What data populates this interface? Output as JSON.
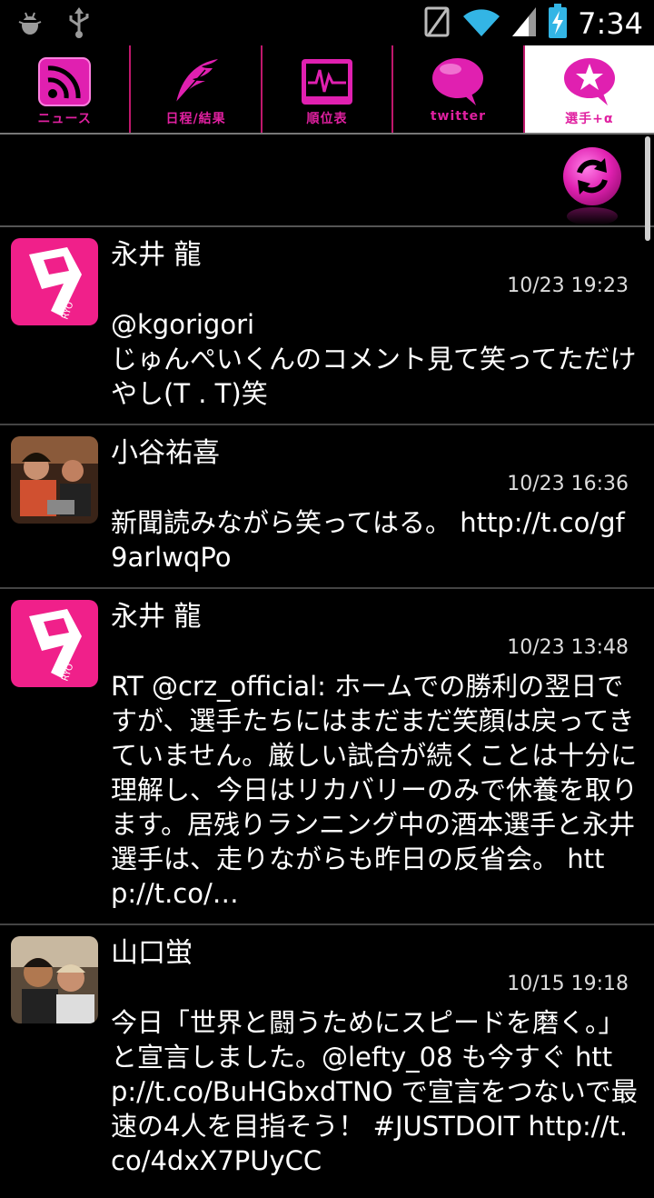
{
  "status_bar": {
    "time": "7:34",
    "icons": [
      "bug-icon",
      "usb-icon",
      "no-sim-icon",
      "wifi-icon",
      "signal-icon",
      "battery-charging-icon"
    ]
  },
  "tabs": [
    {
      "label": "ニュース",
      "icon": "rss-icon"
    },
    {
      "label": "日程/結果",
      "icon": "feather-icon"
    },
    {
      "label": "順位表",
      "icon": "chart-icon"
    },
    {
      "label": "twitter",
      "icon": "speech-bubble-icon"
    },
    {
      "label": "選手+α",
      "icon": "star-bubble-icon",
      "active": true
    }
  ],
  "colors": {
    "accent": "#e020a0",
    "divider": "#444444"
  },
  "tweets": [
    {
      "name": "永井 龍",
      "time": "10/23 19:23",
      "text": "@kgorigori\nじゅんぺいくんのコメント見て笑ってただけやし(T . T)笑",
      "avatar": "pink-9-ryo-avatar"
    },
    {
      "name": "小谷祐喜",
      "time": "10/23 16:36",
      "text": "新聞読みながら笑ってはる。 http://t.co/gf9arlwqPo",
      "avatar": "photo-avatar"
    },
    {
      "name": "永井 龍",
      "time": "10/23 13:48",
      "text": "RT @crz_official: ホームでの勝利の翌日ですが、選手たちにはまだまだ笑顔は戻ってきていません。厳しい試合が続くことは十分に理解し、今日はリカバリーのみで休養を取ります。居残りランニング中の酒本選手と永井選手は、走りながらも昨日の反省会。 http://t.co/…",
      "avatar": "pink-9-ryo-avatar"
    },
    {
      "name": "山口蛍",
      "time": "10/15 19:18",
      "text": "今日「世界と闘うためにスピードを磨く。」と宣言しました。@lefty_08 も今すぐ http://t.co/BuHGbxdTNO で宣言をつないで最速の4人を目指そう！ #JUSTDOIT http://t.co/4dxX7PUyCC",
      "avatar": "photo-avatar-2"
    }
  ]
}
